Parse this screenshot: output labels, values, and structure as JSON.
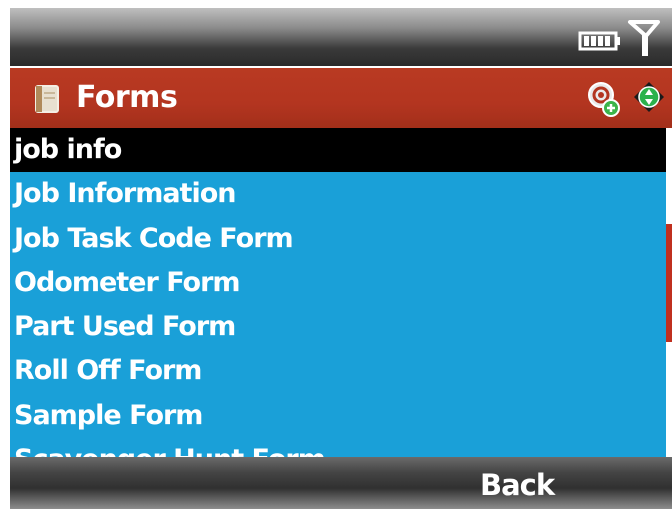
{
  "status_bar": {
    "icons": [
      "battery-icon",
      "signal-icon"
    ]
  },
  "title_bar": {
    "title": "Forms",
    "icons": [
      "forms-icon",
      "sync-icon",
      "nav-icon"
    ]
  },
  "list": {
    "items": [
      {
        "label": "job info",
        "selected": true
      },
      {
        "label": "Job Information",
        "selected": false
      },
      {
        "label": "Job Task Code Form",
        "selected": false
      },
      {
        "label": "Odometer Form",
        "selected": false
      },
      {
        "label": "Part Used Form",
        "selected": false
      },
      {
        "label": "Roll Off Form",
        "selected": false
      },
      {
        "label": "Sample Form",
        "selected": false
      },
      {
        "label": "Scavenger Hunt Form",
        "selected": false
      }
    ]
  },
  "softkeys": {
    "left": "",
    "right": "Back"
  },
  "colors": {
    "title_bar": "#b33520",
    "list_background": "#1aa0d8",
    "selection": "#000000",
    "scroll_thumb": "#c0301f"
  }
}
